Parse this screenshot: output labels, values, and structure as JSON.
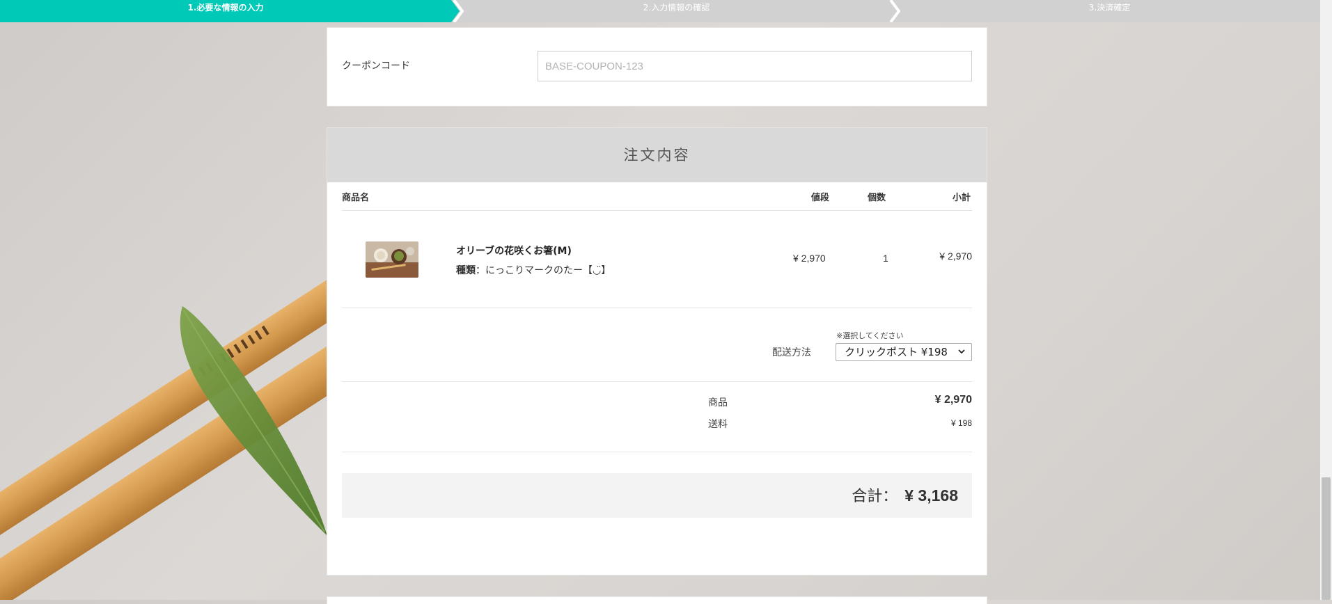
{
  "progress": {
    "steps": [
      {
        "label": "1.必要な情報の入力",
        "active": true
      },
      {
        "label": "2.入力情報の確認",
        "active": false
      },
      {
        "label": "3.決済確定",
        "active": false
      }
    ],
    "active_color": "#00c9b7",
    "inactive_color": "#d1d1d1"
  },
  "coupon": {
    "label": "クーポンコード",
    "placeholder": "BASE-COUPON-123"
  },
  "order": {
    "title": "注文内容",
    "headers": {
      "name": "商品名",
      "price": "値段",
      "qty": "個数",
      "subtotal": "小計"
    },
    "item": {
      "name": "オリーブの花咲くお箸(M)",
      "variant_label": "種類",
      "variant_sep": "：",
      "variant_value": "にっこりマークのたー【◡̈】",
      "price": "¥ 2,970",
      "qty": "1",
      "subtotal": "¥ 2,970",
      "thumbnail_icon": "product-photo"
    },
    "shipping": {
      "note": "※選択してください",
      "label": "配送方法",
      "selected": "クリックポスト ¥198"
    },
    "summary": {
      "items_label": "商品",
      "items_value": "¥ 2,970",
      "shipping_label": "送料",
      "shipping_value": "¥ 198"
    },
    "total": {
      "label": "合計：",
      "value": "¥ 3,168"
    }
  }
}
